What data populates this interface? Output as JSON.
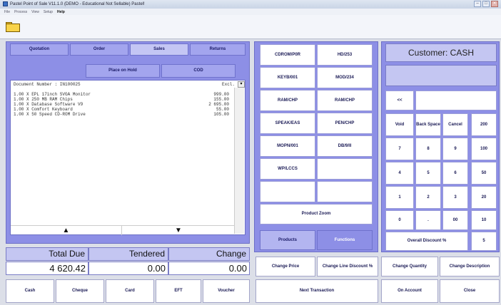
{
  "window": {
    "title": "Pastel Point of Sale V11.1.0 (DEMO - Educational Not Sellable) Pastel!",
    "controls": [
      "–",
      "□",
      "✕"
    ]
  },
  "menu": [
    "File",
    "Process",
    "View",
    "Setup",
    "Help"
  ],
  "toolbar": {
    "open_icon": "folder-icon"
  },
  "doc_tabs": [
    "Quotation",
    "Order",
    "Sales",
    "Returns"
  ],
  "doc_tabs_active": "Sales",
  "actions": {
    "hold": "Place on Hold",
    "cod": "COD"
  },
  "document": {
    "number_label": "Document Number : IN100025",
    "tax_mode": "Excl.",
    "lines": [
      {
        "desc": "1.00 X EPL 17inch SVGA Monitor",
        "amount": "999.00"
      },
      {
        "desc": "1.00 X 250 MB RAM Chips",
        "amount": "155.00"
      },
      {
        "desc": "1.00 X Database Software V9",
        "amount": "2 695.00"
      },
      {
        "desc": "1.00 X Comfort Keyboard",
        "amount": "55.00"
      },
      {
        "desc": "1.00 X 50 Speed CD-ROM Drive",
        "amount": "105.00"
      }
    ]
  },
  "nav": {
    "up": "▲",
    "down": "▼"
  },
  "totals": {
    "total_due_label": "Total Due",
    "tendered_label": "Tendered",
    "change_label": "Change",
    "total_due": "4 620.42",
    "tendered": "0.00",
    "change": "0.00"
  },
  "payments": [
    "Cash",
    "Cheque",
    "Card",
    "EFT",
    "Voucher"
  ],
  "products": [
    "CDROM/P0R",
    "HD/253",
    "KEYB/001",
    "MOD/234",
    "RAM/CHP",
    "RAM/CHP",
    "SPEAK/EAS",
    "PEN/CHP",
    "MOPN/001",
    "DB/9/II",
    "WP/LCCS",
    "",
    "",
    ""
  ],
  "product_zoom": "Product Zoom",
  "mode_tabs": {
    "products": "Products",
    "functions": "Functions"
  },
  "customer": {
    "label": "Customer: CASH"
  },
  "keypad": {
    "back": "<<",
    "headers": [
      "Void",
      "Back Space",
      "Cancel"
    ],
    "rows": [
      [
        "7",
        "8",
        "9"
      ],
      [
        "4",
        "5",
        "6"
      ],
      [
        "1",
        "2",
        "3"
      ],
      [
        "0",
        ".",
        "00"
      ]
    ],
    "denoms": [
      "200",
      "100",
      "50",
      "20",
      "10",
      "5"
    ],
    "overall_discount": "Overall Discount %"
  },
  "functions": [
    "Change Price",
    "Change Line Discount %",
    "Change Quantity",
    "Change Description"
  ],
  "bottom": {
    "next": "Next Transaction",
    "on_account": "On Account",
    "close": "Close"
  }
}
